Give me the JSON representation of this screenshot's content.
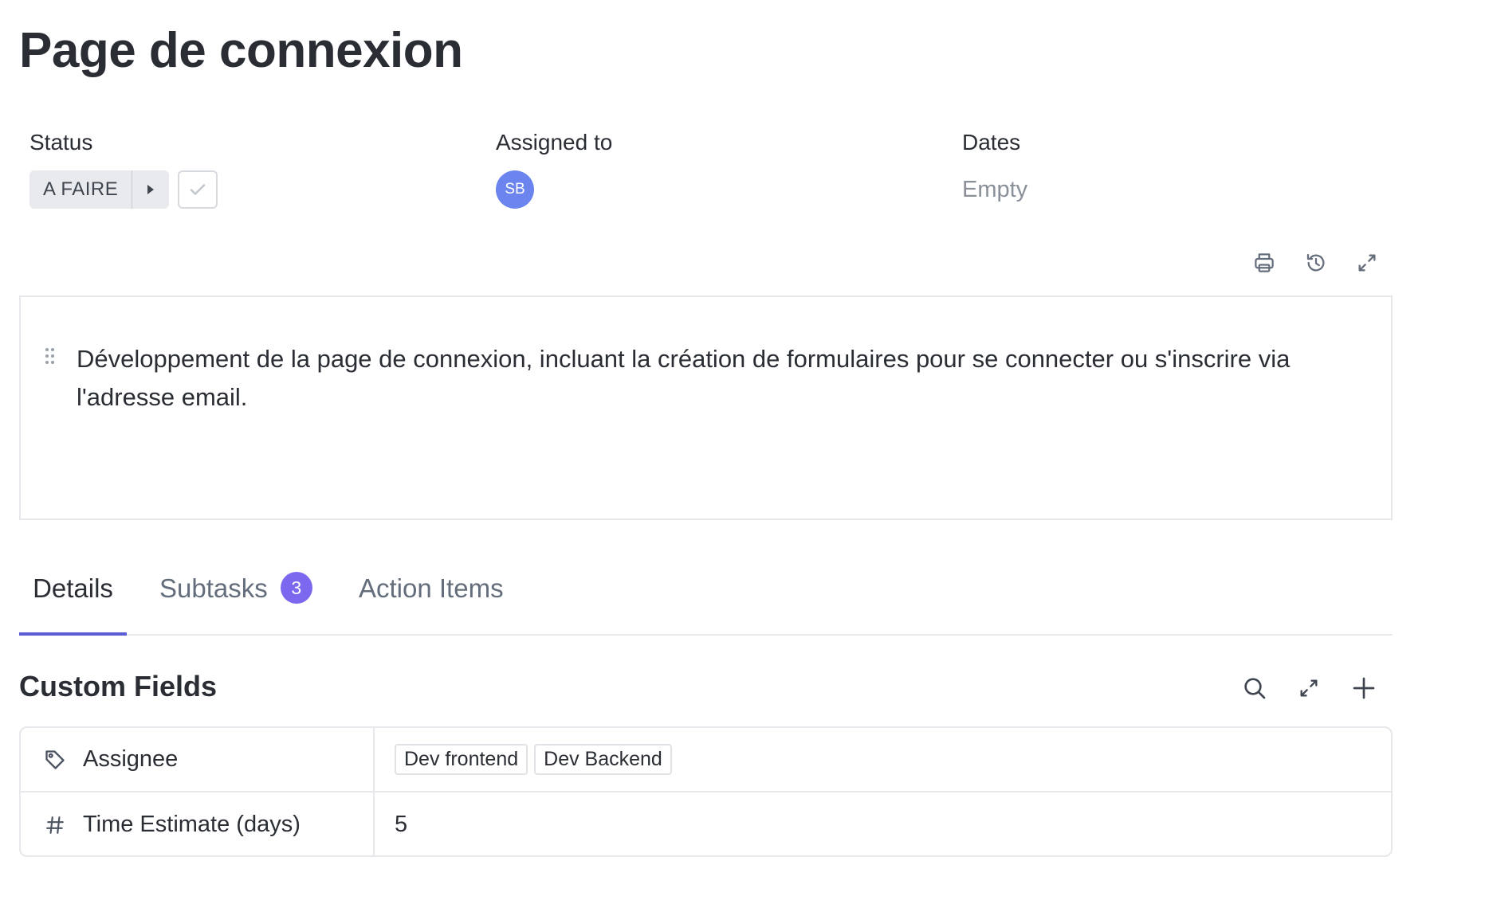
{
  "task": {
    "title": "Page de connexion"
  },
  "meta": {
    "status_label": "Status",
    "status_value": "A FAIRE",
    "assigned_label": "Assigned to",
    "assignee_initials": "SB",
    "dates_label": "Dates",
    "dates_value": "Empty"
  },
  "toolbar": {
    "icons": [
      "print-icon",
      "history-icon",
      "expand-icon"
    ]
  },
  "description": {
    "text": "Développement de la page de connexion, incluant la création de formulaires pour se connecter ou s'inscrire via l'adresse email."
  },
  "tabs": [
    {
      "label": "Details",
      "active": true
    },
    {
      "label": "Subtasks",
      "count": "3"
    },
    {
      "label": "Action Items"
    }
  ],
  "custom_fields": {
    "title": "Custom Fields",
    "icons": [
      "search-icon",
      "expand-icon",
      "plus-icon"
    ],
    "rows": [
      {
        "icon": "tag-icon",
        "name": "Assignee",
        "tags": [
          "Dev frontend",
          "Dev Backend"
        ]
      },
      {
        "icon": "hash-icon",
        "name": "Time Estimate (days)",
        "value": "5"
      }
    ]
  },
  "colors": {
    "accent": "#5b5bd6",
    "badge": "#7b68ee",
    "avatar": "#6b84ee",
    "status_pill": "#e8eaed"
  }
}
